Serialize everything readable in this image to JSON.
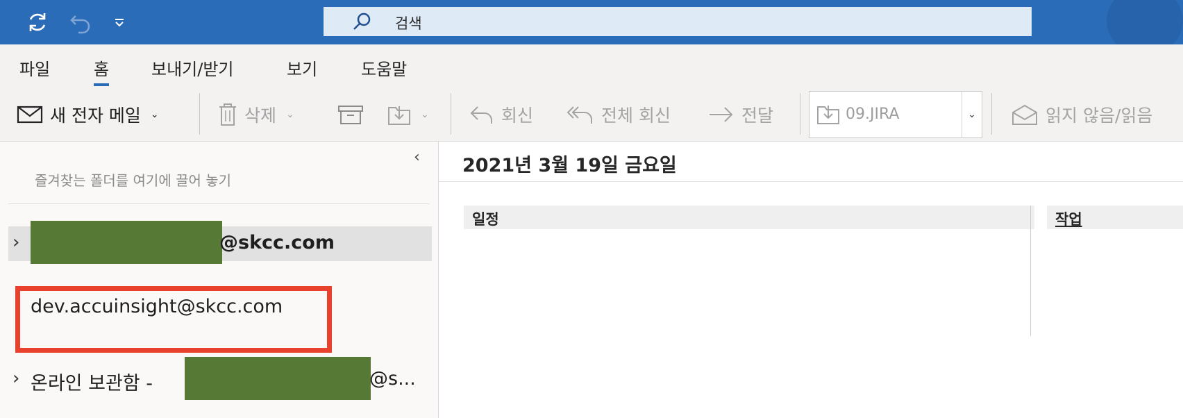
{
  "titlebar": {
    "search_placeholder": "검색",
    "icons": [
      "sync-icon",
      "undo-icon",
      "customize-dropdown-icon",
      "search-icon"
    ]
  },
  "ribbon_tabs": [
    "파일",
    "홈",
    "보내기/받기",
    "보기",
    "도움말"
  ],
  "active_tab": "홈",
  "ribbon": {
    "new_mail": "새 전자 메일",
    "delete": "삭제",
    "reply": "회신",
    "reply_all": "전체 회신",
    "forward": "전달",
    "move_folder": "09.JIRA",
    "unread_read": "읽지 않음/읽음"
  },
  "left_pane": {
    "favorites_hint": "즐겨찾는 폴더를 여기에 끌어 놓기",
    "accounts": [
      {
        "label": "@skcc.com",
        "redacted": true,
        "selected": true
      },
      {
        "label": "dev.accuinsight@skcc.com",
        "redacted": false,
        "selected": false
      },
      {
        "label_prefix": "온라인 보관함 -",
        "label_suffix": "@s...",
        "redacted": true,
        "selected": false
      }
    ]
  },
  "main": {
    "date_header": "2021년 3월 19일 금요일",
    "sections": [
      "일정",
      "작업"
    ]
  },
  "colors": {
    "titlebar": "#2b6cb8",
    "search_box": "#deeaf6",
    "ribbon_bg": "#f3f2f1",
    "redaction": "#567a35",
    "highlight_box": "#e8412e"
  }
}
